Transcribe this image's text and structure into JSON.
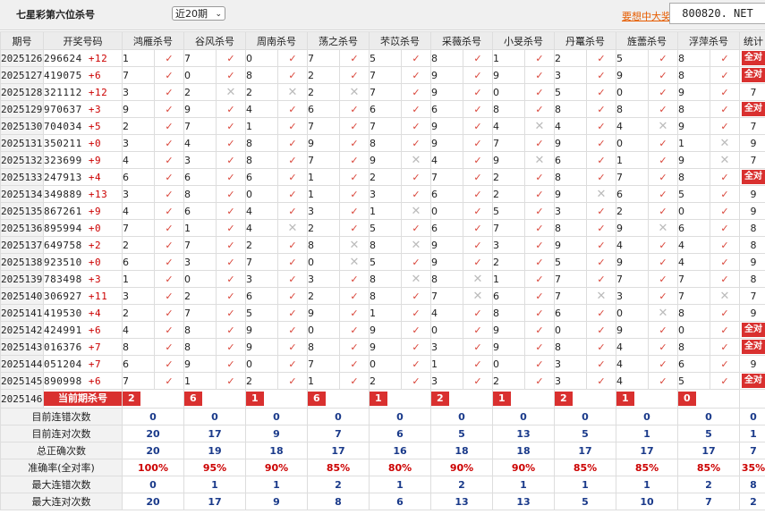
{
  "header": {
    "title": "七星彩第六位杀号",
    "select_value": "近20期",
    "link_text": "要想中大奖，",
    "badge_text": "800820. NET"
  },
  "columns": [
    "期号",
    "开奖号码",
    "鸿雁杀号",
    "谷风杀号",
    "周南杀号",
    "荡之杀号",
    "芣苡杀号",
    "采薇杀号",
    "小旻杀号",
    "丹鼍杀号",
    "旌蘦杀号",
    "浮萍杀号",
    "统计"
  ],
  "rows": [
    {
      "period": "2025126",
      "digits": "296624",
      "sum": "+12",
      "kills": [
        [
          "1",
          "ok"
        ],
        [
          "7",
          "ok"
        ],
        [
          "0",
          "ok"
        ],
        [
          "7",
          "ok"
        ],
        [
          "5",
          "ok"
        ],
        [
          "8",
          "ok"
        ],
        [
          "1",
          "ok"
        ],
        [
          "2",
          "ok"
        ],
        [
          "5",
          "ok"
        ],
        [
          "8",
          "ok"
        ]
      ],
      "stat": "全对"
    },
    {
      "period": "2025127",
      "digits": "419075",
      "sum": "+6",
      "kills": [
        [
          "7",
          "ok"
        ],
        [
          "0",
          "ok"
        ],
        [
          "8",
          "ok"
        ],
        [
          "2",
          "ok"
        ],
        [
          "7",
          "ok"
        ],
        [
          "9",
          "ok"
        ],
        [
          "9",
          "ok"
        ],
        [
          "3",
          "ok"
        ],
        [
          "9",
          "ok"
        ],
        [
          "8",
          "ok"
        ]
      ],
      "stat": "全对"
    },
    {
      "period": "2025128",
      "digits": "321112",
      "sum": "+12",
      "kills": [
        [
          "3",
          "ok"
        ],
        [
          "2",
          "no"
        ],
        [
          "2",
          "no"
        ],
        [
          "2",
          "no"
        ],
        [
          "7",
          "ok"
        ],
        [
          "9",
          "ok"
        ],
        [
          "0",
          "ok"
        ],
        [
          "5",
          "ok"
        ],
        [
          "0",
          "ok"
        ],
        [
          "9",
          "ok"
        ]
      ],
      "stat": "7"
    },
    {
      "period": "2025129",
      "digits": "970637",
      "sum": "+3",
      "kills": [
        [
          "9",
          "ok"
        ],
        [
          "9",
          "ok"
        ],
        [
          "4",
          "ok"
        ],
        [
          "6",
          "ok"
        ],
        [
          "6",
          "ok"
        ],
        [
          "6",
          "ok"
        ],
        [
          "8",
          "ok"
        ],
        [
          "8",
          "ok"
        ],
        [
          "8",
          "ok"
        ],
        [
          "8",
          "ok"
        ]
      ],
      "stat": "全对"
    },
    {
      "period": "2025130",
      "digits": "704034",
      "sum": "+5",
      "kills": [
        [
          "2",
          "ok"
        ],
        [
          "7",
          "ok"
        ],
        [
          "1",
          "ok"
        ],
        [
          "7",
          "ok"
        ],
        [
          "7",
          "ok"
        ],
        [
          "9",
          "ok"
        ],
        [
          "4",
          "no"
        ],
        [
          "4",
          "ok"
        ],
        [
          "4",
          "no"
        ],
        [
          "9",
          "ok"
        ]
      ],
      "stat": "7"
    },
    {
      "period": "2025131",
      "digits": "350211",
      "sum": "+0",
      "kills": [
        [
          "3",
          "ok"
        ],
        [
          "4",
          "ok"
        ],
        [
          "8",
          "ok"
        ],
        [
          "9",
          "ok"
        ],
        [
          "8",
          "ok"
        ],
        [
          "9",
          "ok"
        ],
        [
          "7",
          "ok"
        ],
        [
          "9",
          "ok"
        ],
        [
          "0",
          "ok"
        ],
        [
          "1",
          "no"
        ]
      ],
      "stat": "9"
    },
    {
      "period": "2025132",
      "digits": "323699",
      "sum": "+9",
      "kills": [
        [
          "4",
          "ok"
        ],
        [
          "3",
          "ok"
        ],
        [
          "8",
          "ok"
        ],
        [
          "7",
          "ok"
        ],
        [
          "9",
          "no"
        ],
        [
          "4",
          "ok"
        ],
        [
          "9",
          "no"
        ],
        [
          "6",
          "ok"
        ],
        [
          "1",
          "ok"
        ],
        [
          "9",
          "no"
        ]
      ],
      "stat": "7"
    },
    {
      "period": "2025133",
      "digits": "247913",
      "sum": "+4",
      "kills": [
        [
          "6",
          "ok"
        ],
        [
          "6",
          "ok"
        ],
        [
          "6",
          "ok"
        ],
        [
          "1",
          "ok"
        ],
        [
          "2",
          "ok"
        ],
        [
          "7",
          "ok"
        ],
        [
          "2",
          "ok"
        ],
        [
          "8",
          "ok"
        ],
        [
          "7",
          "ok"
        ],
        [
          "8",
          "ok"
        ]
      ],
      "stat": "全对"
    },
    {
      "period": "2025134",
      "digits": "349889",
      "sum": "+13",
      "kills": [
        [
          "3",
          "ok"
        ],
        [
          "8",
          "ok"
        ],
        [
          "0",
          "ok"
        ],
        [
          "1",
          "ok"
        ],
        [
          "3",
          "ok"
        ],
        [
          "6",
          "ok"
        ],
        [
          "2",
          "ok"
        ],
        [
          "9",
          "no"
        ],
        [
          "6",
          "ok"
        ],
        [
          "5",
          "ok"
        ]
      ],
      "stat": "9"
    },
    {
      "period": "2025135",
      "digits": "867261",
      "sum": "+9",
      "kills": [
        [
          "4",
          "ok"
        ],
        [
          "6",
          "ok"
        ],
        [
          "4",
          "ok"
        ],
        [
          "3",
          "ok"
        ],
        [
          "1",
          "no"
        ],
        [
          "0",
          "ok"
        ],
        [
          "5",
          "ok"
        ],
        [
          "3",
          "ok"
        ],
        [
          "2",
          "ok"
        ],
        [
          "0",
          "ok"
        ]
      ],
      "stat": "9"
    },
    {
      "period": "2025136",
      "digits": "895994",
      "sum": "+0",
      "kills": [
        [
          "7",
          "ok"
        ],
        [
          "1",
          "ok"
        ],
        [
          "4",
          "no"
        ],
        [
          "2",
          "ok"
        ],
        [
          "5",
          "ok"
        ],
        [
          "6",
          "ok"
        ],
        [
          "7",
          "ok"
        ],
        [
          "8",
          "ok"
        ],
        [
          "9",
          "no"
        ],
        [
          "6",
          "ok"
        ]
      ],
      "stat": "8"
    },
    {
      "period": "2025137",
      "digits": "649758",
      "sum": "+2",
      "kills": [
        [
          "2",
          "ok"
        ],
        [
          "7",
          "ok"
        ],
        [
          "2",
          "ok"
        ],
        [
          "8",
          "no"
        ],
        [
          "8",
          "no"
        ],
        [
          "9",
          "ok"
        ],
        [
          "3",
          "ok"
        ],
        [
          "9",
          "ok"
        ],
        [
          "4",
          "ok"
        ],
        [
          "4",
          "ok"
        ]
      ],
      "stat": "8"
    },
    {
      "period": "2025138",
      "digits": "923510",
      "sum": "+0",
      "kills": [
        [
          "6",
          "ok"
        ],
        [
          "3",
          "ok"
        ],
        [
          "7",
          "ok"
        ],
        [
          "0",
          "no"
        ],
        [
          "5",
          "ok"
        ],
        [
          "9",
          "ok"
        ],
        [
          "2",
          "ok"
        ],
        [
          "5",
          "ok"
        ],
        [
          "9",
          "ok"
        ],
        [
          "4",
          "ok"
        ]
      ],
      "stat": "9"
    },
    {
      "period": "2025139",
      "digits": "783498",
      "sum": "+3",
      "kills": [
        [
          "1",
          "ok"
        ],
        [
          "0",
          "ok"
        ],
        [
          "3",
          "ok"
        ],
        [
          "3",
          "ok"
        ],
        [
          "8",
          "no"
        ],
        [
          "8",
          "no"
        ],
        [
          "1",
          "ok"
        ],
        [
          "7",
          "ok"
        ],
        [
          "7",
          "ok"
        ],
        [
          "7",
          "ok"
        ]
      ],
      "stat": "8"
    },
    {
      "period": "2025140",
      "digits": "306927",
      "sum": "+11",
      "kills": [
        [
          "3",
          "ok"
        ],
        [
          "2",
          "ok"
        ],
        [
          "6",
          "ok"
        ],
        [
          "2",
          "ok"
        ],
        [
          "8",
          "ok"
        ],
        [
          "7",
          "no"
        ],
        [
          "6",
          "ok"
        ],
        [
          "7",
          "no"
        ],
        [
          "3",
          "ok"
        ],
        [
          "7",
          "no"
        ]
      ],
      "stat": "7"
    },
    {
      "period": "2025141",
      "digits": "419530",
      "sum": "+4",
      "kills": [
        [
          "2",
          "ok"
        ],
        [
          "7",
          "ok"
        ],
        [
          "5",
          "ok"
        ],
        [
          "9",
          "ok"
        ],
        [
          "1",
          "ok"
        ],
        [
          "4",
          "ok"
        ],
        [
          "8",
          "ok"
        ],
        [
          "6",
          "ok"
        ],
        [
          "0",
          "no"
        ],
        [
          "8",
          "ok"
        ]
      ],
      "stat": "9"
    },
    {
      "period": "2025142",
      "digits": "424991",
      "sum": "+6",
      "kills": [
        [
          "4",
          "ok"
        ],
        [
          "8",
          "ok"
        ],
        [
          "9",
          "ok"
        ],
        [
          "0",
          "ok"
        ],
        [
          "9",
          "ok"
        ],
        [
          "0",
          "ok"
        ],
        [
          "9",
          "ok"
        ],
        [
          "0",
          "ok"
        ],
        [
          "9",
          "ok"
        ],
        [
          "0",
          "ok"
        ]
      ],
      "stat": "全对"
    },
    {
      "period": "2025143",
      "digits": "016376",
      "sum": "+7",
      "kills": [
        [
          "8",
          "ok"
        ],
        [
          "8",
          "ok"
        ],
        [
          "9",
          "ok"
        ],
        [
          "8",
          "ok"
        ],
        [
          "9",
          "ok"
        ],
        [
          "3",
          "ok"
        ],
        [
          "9",
          "ok"
        ],
        [
          "8",
          "ok"
        ],
        [
          "4",
          "ok"
        ],
        [
          "8",
          "ok"
        ]
      ],
      "stat": "全对"
    },
    {
      "period": "2025144",
      "digits": "051204",
      "sum": "+7",
      "kills": [
        [
          "6",
          "ok"
        ],
        [
          "9",
          "ok"
        ],
        [
          "0",
          "ok"
        ],
        [
          "7",
          "ok"
        ],
        [
          "0",
          "ok"
        ],
        [
          "1",
          "ok"
        ],
        [
          "0",
          "ok"
        ],
        [
          "3",
          "ok"
        ],
        [
          "4",
          "ok"
        ],
        [
          "6",
          "ok"
        ]
      ],
      "stat": "9"
    },
    {
      "period": "2025145",
      "digits": "890998",
      "sum": "+6",
      "kills": [
        [
          "7",
          "ok"
        ],
        [
          "1",
          "ok"
        ],
        [
          "2",
          "ok"
        ],
        [
          "1",
          "ok"
        ],
        [
          "2",
          "ok"
        ],
        [
          "3",
          "ok"
        ],
        [
          "2",
          "ok"
        ],
        [
          "3",
          "ok"
        ],
        [
          "4",
          "ok"
        ],
        [
          "5",
          "ok"
        ]
      ],
      "stat": "全对"
    }
  ],
  "current": {
    "period": "2025146",
    "label": "当前期杀号",
    "kills": [
      "2",
      "6",
      "1",
      "6",
      "1",
      "2",
      "1",
      "2",
      "1",
      "0"
    ]
  },
  "stats": [
    {
      "label": "目前连错次数",
      "values": [
        "0",
        "0",
        "0",
        "0",
        "0",
        "0",
        "0",
        "0",
        "0",
        "0",
        "0"
      ],
      "red": false
    },
    {
      "label": "目前连对次数",
      "values": [
        "20",
        "17",
        "9",
        "7",
        "6",
        "5",
        "13",
        "5",
        "1",
        "5",
        "1"
      ],
      "red": false
    },
    {
      "label": "总正确次数",
      "values": [
        "20",
        "19",
        "18",
        "17",
        "16",
        "18",
        "18",
        "17",
        "17",
        "17",
        "7"
      ],
      "red": false
    },
    {
      "label": "准确率(全对率)",
      "values": [
        "100%",
        "95%",
        "90%",
        "85%",
        "80%",
        "90%",
        "90%",
        "85%",
        "85%",
        "85%",
        "35%"
      ],
      "red": true
    },
    {
      "label": "最大连错次数",
      "values": [
        "0",
        "1",
        "1",
        "2",
        "1",
        "2",
        "1",
        "1",
        "1",
        "2",
        "8"
      ],
      "red": false
    },
    {
      "label": "最大连对次数",
      "values": [
        "20",
        "17",
        "9",
        "8",
        "6",
        "13",
        "13",
        "5",
        "10",
        "7",
        "2"
      ],
      "red": false
    }
  ]
}
